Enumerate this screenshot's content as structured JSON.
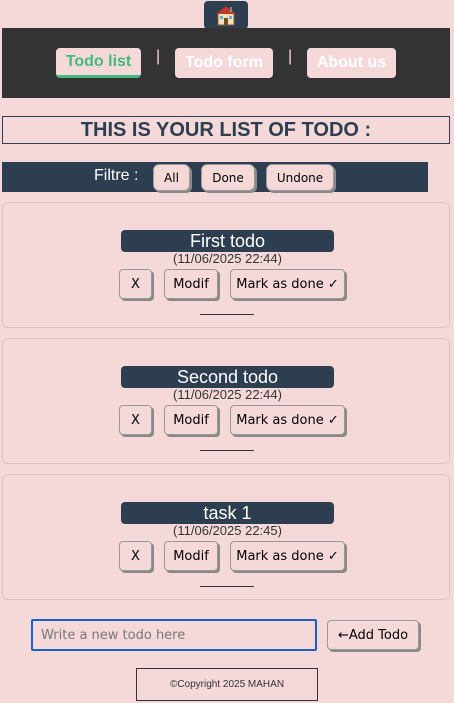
{
  "logo": {
    "icon": "house-icon"
  },
  "nav": {
    "items": [
      {
        "label": "Todo list",
        "active": true
      },
      {
        "label": "Todo form",
        "active": false
      },
      {
        "label": "About us",
        "active": false
      }
    ],
    "separator": "|"
  },
  "heading": "THIS IS YOUR LIST OF TODO :",
  "filter": {
    "label": "Filtre :",
    "buttons": [
      "All",
      "Done",
      "Undone"
    ]
  },
  "todos": [
    {
      "title": "First todo",
      "date": "(11/06/2025 22:44)"
    },
    {
      "title": "Second todo",
      "date": "(11/06/2025 22:44)"
    },
    {
      "title": "task 1",
      "date": "(11/06/2025 22:45)"
    }
  ],
  "todo_actions": {
    "delete": "X",
    "modify": "Modif",
    "mark_done": "Mark as done ✓"
  },
  "new_todo": {
    "placeholder": "Write a new todo here",
    "value": "",
    "add_label": "←Add Todo"
  },
  "footer": "©Copyright 2025 MAHAN",
  "colors": {
    "background": "#f5d9d9",
    "navbar": "#333333",
    "dark": "#2c3e50",
    "active": "#42b983",
    "input_border": "#1a5fc8"
  }
}
